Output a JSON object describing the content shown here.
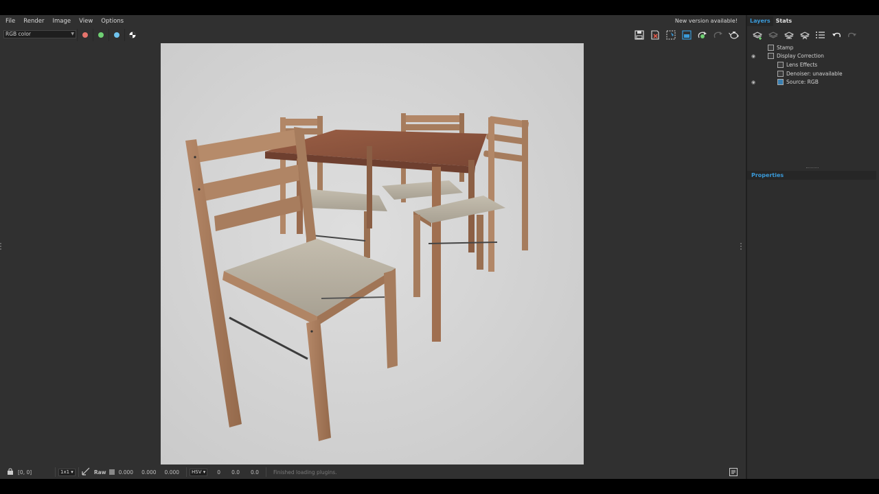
{
  "menubar": {
    "items": [
      "File",
      "Render",
      "Image",
      "View",
      "Options"
    ],
    "notice": "New version available!"
  },
  "toolbar": {
    "channel": "RGB color",
    "channel_colors": {
      "red": "#e5746c",
      "green": "#6fcf73",
      "blue": "#6fc3ee"
    },
    "icons": [
      "save-image-icon",
      "clear-image-icon",
      "region-render-icon",
      "track-mouse-icon",
      "start-render-icon",
      "stop-render-icon",
      "teapot-icon"
    ]
  },
  "render": {
    "background": "#dcdcdc",
    "wood_color": "#a57a5a",
    "cushion_color": "#b9b2a3"
  },
  "panel": {
    "tabs": [
      "Layers",
      "Stats"
    ],
    "layers": [
      {
        "label": "Stamp",
        "visible": false,
        "indent": 1,
        "icon": "stamp-icon"
      },
      {
        "label": "Display Correction",
        "visible": true,
        "indent": 1,
        "icon": "curve-icon"
      },
      {
        "label": "Lens Effects",
        "visible": false,
        "indent": 2,
        "icon": "lens-effects-icon"
      },
      {
        "label": "Denoiser: unavailable",
        "visible": false,
        "indent": 2,
        "icon": "denoiser-icon"
      },
      {
        "label": "Source: RGB",
        "visible": true,
        "indent": 2,
        "icon": "source-icon"
      }
    ],
    "properties_title": "Properties"
  },
  "statusbar": {
    "coords": "[0, 0]",
    "zoom": "1x1",
    "raw_label": "Raw",
    "rgb_values": [
      "0.000",
      "0.000",
      "0.000"
    ],
    "color_space": "HSV",
    "hsv_values": [
      "0",
      "0.0",
      "0.0"
    ],
    "message": "Finished loading plugins."
  }
}
